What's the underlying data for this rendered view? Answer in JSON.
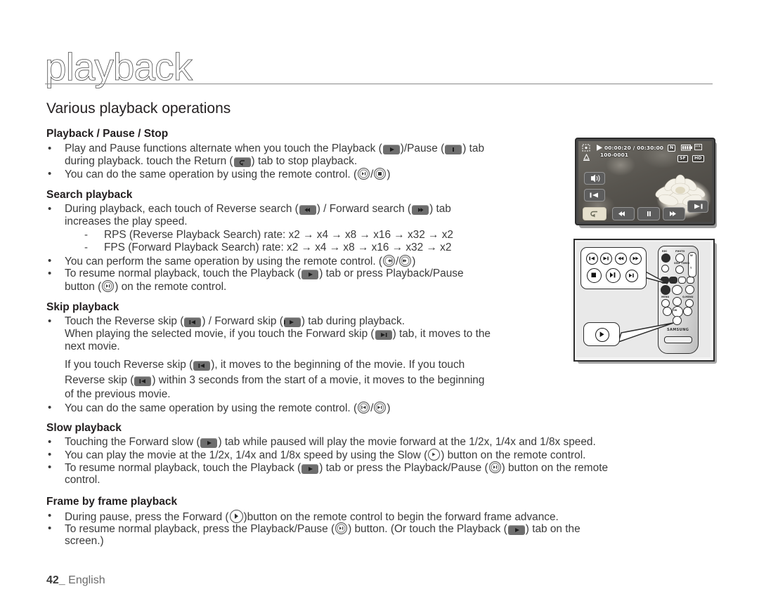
{
  "page": {
    "chapter_title": "playback",
    "section_title": "Various playback operations",
    "footer_page": "42_",
    "footer_language": "English"
  },
  "sections": [
    {
      "heading": "Playback / Pause / Stop",
      "lines": [
        {
          "bullet": "•",
          "pre": "Play and Pause functions alternate when you touch the Playback (",
          "icons": [
            "play-tab"
          ],
          "mid": ")/Pause (",
          "icons2": [
            "pause-tab"
          ],
          "post": ") tab"
        },
        {
          "bullet": "",
          "pre": "during playback. touch the Return (",
          "icons": [
            "return-tab"
          ],
          "post": ") tab to stop playback."
        },
        {
          "bullet": "•",
          "pre": "You can do the same operation by using the remote control. (",
          "icons": [
            "play-pause-remote"
          ],
          "mid": "/",
          "icons2": [
            "stop-remote"
          ],
          "post": ")"
        }
      ]
    },
    {
      "heading": "Search playback",
      "lines": [
        {
          "bullet": "•",
          "pre": "During playback, each touch of Reverse search (",
          "icons": [
            "rew-tab"
          ],
          "mid": ") / Forward search (",
          "icons2": [
            "ff-tab"
          ],
          "post": ") tab"
        },
        {
          "bullet": "",
          "pre": "increases the play speed."
        },
        {
          "dash": "-",
          "pre": "RPS (Reverse Playback Search) rate: x2 → x4 → x8 → x16 → x32 → x2"
        },
        {
          "dash": "-",
          "pre": "FPS (Forward Playback Search) rate: x2 → x4 → x8 → x16 → x32 → x2"
        },
        {
          "bullet": "•",
          "pre": "You can perform the same operation by using the remote control. (",
          "icons": [
            "rew-remote"
          ],
          "mid": "/",
          "icons2": [
            "ff-remote"
          ],
          "post": ")"
        },
        {
          "bullet": "•",
          "pre": "To resume normal playback, touch the Playback (",
          "icons": [
            "play-tab"
          ],
          "post": ") tab or press Playback/Pause"
        },
        {
          "bullet": "",
          "pre": "button (",
          "icons": [
            "play-pause-remote"
          ],
          "post": ") on the remote control."
        }
      ]
    },
    {
      "heading": "Skip playback",
      "lines": [
        {
          "bullet": "•",
          "pre": "Touch the Reverse skip (",
          "icons": [
            "skip-back-tab"
          ],
          "mid": ") / Forward skip (",
          "icons2": [
            "skip-fwd-tab"
          ],
          "post": ") tab during playback."
        },
        {
          "bullet": "",
          "pre": "When playing the selected movie, if you touch the Forward skip (",
          "icons": [
            "skip-fwd-tab"
          ],
          "post": ") tab, it moves to the"
        },
        {
          "bullet": "",
          "pre": "next movie."
        },
        {
          "bullet": "",
          "pre": "If you touch Reverse skip (",
          "icons": [
            "skip-back-tab"
          ],
          "post": "), it moves to the beginning of the movie. If you touch"
        },
        {
          "bullet": "",
          "pre": "Reverse skip (",
          "icons": [
            "skip-back-tab"
          ],
          "post": ") within 3 seconds from the start of a movie, it moves to the beginning"
        },
        {
          "bullet": "",
          "pre": "of the previous movie."
        },
        {
          "bullet": "•",
          "pre": "You can do the same operation by using the remote control. (",
          "icons": [
            "skip-back-remote"
          ],
          "mid": "/",
          "icons2": [
            "skip-fwd-remote"
          ],
          "post": ")"
        }
      ]
    },
    {
      "heading": "Slow playback",
      "lines": [
        {
          "bullet": "•",
          "pre": "Touching the Forward slow (",
          "icons": [
            "slow-tab"
          ],
          "post": ") tab while paused will play the movie forward at the 1/2x, 1/4x and 1/8x speed."
        },
        {
          "bullet": "•",
          "pre": "You can play the movie at the 1/2x, 1/4x and 1/8x speed by using the Slow (",
          "icons": [
            "slow-remote"
          ],
          "post": ") button on the remote control."
        },
        {
          "bullet": "•",
          "pre": "To resume normal playback, touch the Playback (",
          "icons": [
            "play-tab"
          ],
          "mid": ") tab or press the Playback/Pause (",
          "icons2": [
            "play-pause-remote"
          ],
          "post": ") button on the remote"
        },
        {
          "bullet": "",
          "pre": "control."
        }
      ]
    },
    {
      "heading": "Frame by frame playback",
      "lines": [
        {
          "bullet": "•",
          "pre": "During pause, press the Forward (",
          "icons": [
            "frame-fwd-remote"
          ],
          "post": ")button on the remote control to begin the forward frame advance."
        },
        {
          "bullet": "•",
          "pre": "To resume normal playback, press the Playback/Pause (",
          "icons": [
            "play-pause-remote"
          ],
          "mid": ") button. (Or touch the Playback (",
          "icons2": [
            "play-tab"
          ],
          "post": ") tab on the"
        },
        {
          "bullet": "",
          "pre": "screen.)"
        }
      ]
    }
  ],
  "lcd_figure": {
    "name": "camcorder-lcd-playback-screen",
    "timecode": "00:00:20 / 00:30:00",
    "file_number": "100-0001",
    "badges": [
      "N",
      "SF",
      "HD"
    ],
    "tabs": [
      "volume",
      "skip-back",
      "skip-forward",
      "return",
      "rewind",
      "pause",
      "fast-forward"
    ]
  },
  "remote_figure": {
    "name": "remote-control-illustration",
    "brand": "SAMSUNG",
    "callout_top_buttons": [
      "skip-back",
      "skip-forward",
      "rewind",
      "fast-forward",
      "stop",
      "play-pause",
      "slow"
    ],
    "callout_bottom_buttons": [
      "forward-frame"
    ],
    "labels": [
      "PHOTO",
      "REC",
      "SELF TIMER",
      "W",
      "T",
      "MENU",
      "Q.MENU",
      "OK"
    ]
  }
}
